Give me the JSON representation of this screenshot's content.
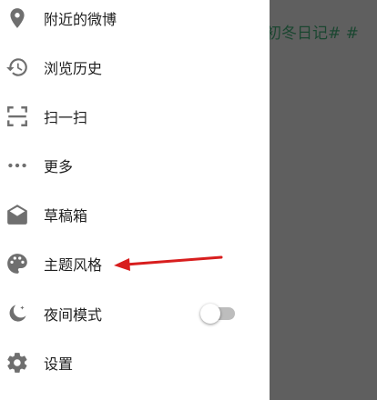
{
  "background": {
    "title_fragment": "初冬日记# #"
  },
  "colors": {
    "icon": "#6f6f6f",
    "text": "#1f1f1f",
    "overlay": "#5f5f5f",
    "annotation_arrow": "#d81e1e"
  },
  "drawer": {
    "items": [
      {
        "label": "附近的微博",
        "icon": "location-pin-icon"
      },
      {
        "label": "浏览历史",
        "icon": "history-icon"
      },
      {
        "label": "扫一扫",
        "icon": "scan-icon"
      },
      {
        "label": "更多",
        "icon": "more-dots-icon"
      },
      {
        "label": "草稿箱",
        "icon": "drafts-icon"
      },
      {
        "label": "主题风格",
        "icon": "palette-icon"
      },
      {
        "label": "夜间模式",
        "icon": "night-mode-icon",
        "toggle_on": false
      },
      {
        "label": "设置",
        "icon": "settings-gear-icon"
      }
    ]
  }
}
